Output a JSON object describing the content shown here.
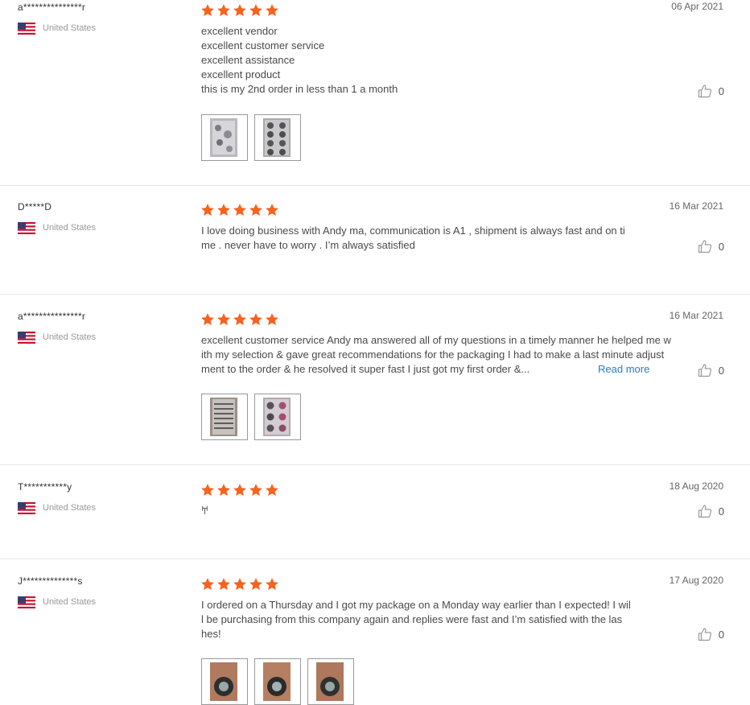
{
  "reviews": [
    {
      "user": "a***************r",
      "country": "United States",
      "rating": 5,
      "date": "06 Apr 2021",
      "lines": [
        "excellent vendor",
        "excellent customer service",
        "excellent assistance",
        "excellent product",
        "this is my 2nd order in less than 1 a month"
      ],
      "likes": "0"
    },
    {
      "user": "D*****D",
      "country": "United States",
      "rating": 5,
      "date": "16 Mar 2021",
      "lines": [
        "I love doing business with Andy ma, communication is A1 , shipment is always fast and on ti",
        "me . never have to worry . I’m always satisfied"
      ],
      "likes": "0"
    },
    {
      "user": "a***************r",
      "country": "United States",
      "rating": 5,
      "date": "16 Mar 2021",
      "lines": [
        "excellent customer service Andy ma answered all of my questions in a timely manner he helped me w",
        "ith my selection & gave great recommendations for the packaging I had to make a last minute adjust",
        "ment to the order & he resolved it super fast I just got my first order &..."
      ],
      "read_more": "Read more",
      "likes": "0"
    },
    {
      "user": "T***********y",
      "country": "United States",
      "rating": 5,
      "date": "18 Aug 2020",
      "lines": [
        "𐀀"
      ],
      "likes": "0"
    },
    {
      "user": "J**************s",
      "country": "United States",
      "rating": 5,
      "date": "17 Aug 2020",
      "lines": [
        "I ordered on a Thursday and I got my package on a Monday way earlier than I expected! I wil",
        "l be purchasing from this company again and replies were fast and I’m satisfied with the las",
        "hes!"
      ],
      "likes": "0"
    }
  ],
  "colors": {
    "star": "#f5631f",
    "link": "#2e7bbf",
    "flag_red": "#c8102e",
    "flag_blue": "#3c3b6e"
  }
}
